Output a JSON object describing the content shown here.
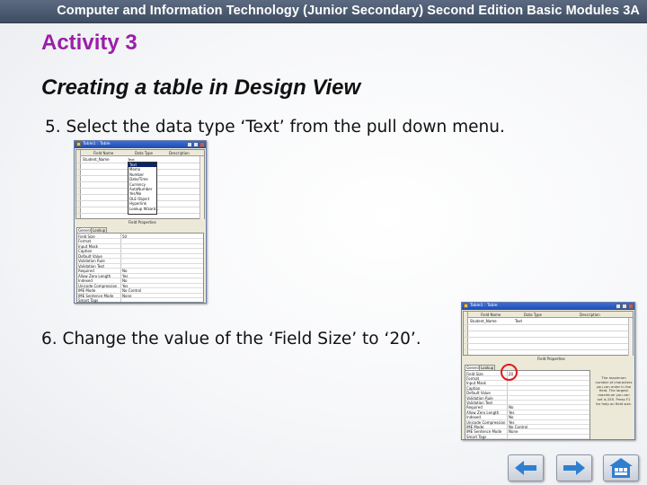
{
  "header": {
    "title": "Computer and Information Technology (Junior Secondary) Second Edition Basic Modules 3A"
  },
  "activity_title": "Activity 3",
  "page_heading": "Creating a table in Design View",
  "steps": {
    "step5": "5. Select the data type ‘Text’ from the pull down menu.",
    "step6": "6. Change the value of the ‘Field Size’ to ‘20’."
  },
  "screenshot1": {
    "window_title": "Table1 : Table",
    "columns": [
      "Field Name",
      "Data Type",
      "Description"
    ],
    "field_name": "Student_Name",
    "data_type_value": "Text",
    "dropdown_options": [
      "Text",
      "Memo",
      "Number",
      "Date/Time",
      "Currency",
      "AutoNumber",
      "Yes/No",
      "OLE Object",
      "Hyperlink",
      "Lookup Wizard..."
    ],
    "selected_option": "Text",
    "field_properties_label": "Field Properties",
    "tabs": [
      "General",
      "Lookup"
    ],
    "properties": [
      {
        "name": "Field Size",
        "value": "50"
      },
      {
        "name": "Format",
        "value": ""
      },
      {
        "name": "Input Mask",
        "value": ""
      },
      {
        "name": "Caption",
        "value": ""
      },
      {
        "name": "Default Value",
        "value": ""
      },
      {
        "name": "Validation Rule",
        "value": ""
      },
      {
        "name": "Validation Text",
        "value": ""
      },
      {
        "name": "Required",
        "value": "No"
      },
      {
        "name": "Allow Zero Length",
        "value": "Yes"
      },
      {
        "name": "Indexed",
        "value": "No"
      },
      {
        "name": "Unicode Compression",
        "value": "Yes"
      },
      {
        "name": "IME Mode",
        "value": "No Control"
      },
      {
        "name": "IME Sentence Mode",
        "value": "None"
      },
      {
        "name": "Smart Tags",
        "value": ""
      }
    ]
  },
  "screenshot2": {
    "window_title": "Table1 : Table",
    "columns": [
      "Field Name",
      "Data Type",
      "Description"
    ],
    "field_name": "Student_Name",
    "data_type_value": "Text",
    "field_properties_label": "Field Properties",
    "tabs": [
      "General",
      "Lookup"
    ],
    "field_size_value": "20",
    "help_text": "The maximum number of characters you can enter in the field. The largest maximum you can set is 255. Press F1 for help on field size.",
    "properties": [
      {
        "name": "Field Size",
        "value": "20"
      },
      {
        "name": "Format",
        "value": ""
      },
      {
        "name": "Input Mask",
        "value": ""
      },
      {
        "name": "Caption",
        "value": ""
      },
      {
        "name": "Default Value",
        "value": ""
      },
      {
        "name": "Validation Rule",
        "value": ""
      },
      {
        "name": "Validation Text",
        "value": ""
      },
      {
        "name": "Required",
        "value": "No"
      },
      {
        "name": "Allow Zero Length",
        "value": "Yes"
      },
      {
        "name": "Indexed",
        "value": "No"
      },
      {
        "name": "Unicode Compression",
        "value": "Yes"
      },
      {
        "name": "IME Mode",
        "value": "No Control"
      },
      {
        "name": "IME Sentence Mode",
        "value": "None"
      },
      {
        "name": "Smart Tags",
        "value": ""
      }
    ]
  },
  "nav": {
    "previous": "previous-arrow-icon",
    "next": "next-arrow-icon",
    "home": "home-icon"
  },
  "colors": {
    "activity_title": "#9b1fa8",
    "header_bar": "#4a586e",
    "nav_arrow": "#2f7fd0",
    "highlight": "#e01818"
  }
}
